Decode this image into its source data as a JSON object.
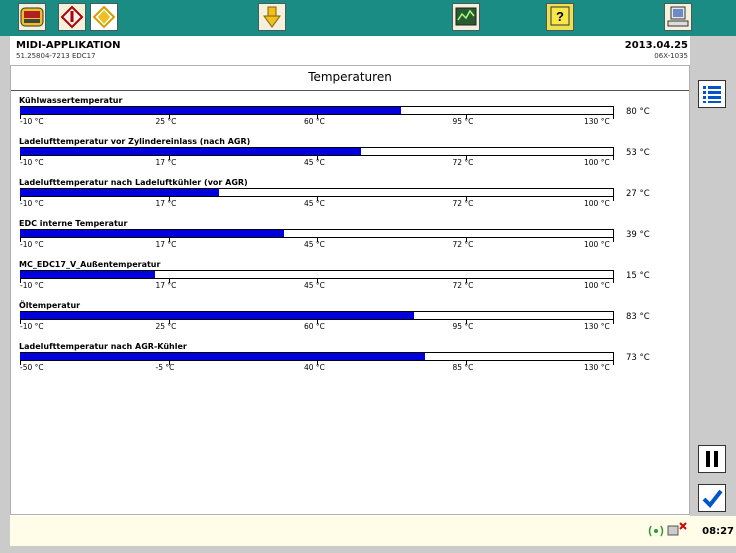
{
  "toolbar": {
    "buttons": [
      {
        "id": "man-logo",
        "icon": "man-logo-icon",
        "label": "MAN"
      },
      {
        "id": "diagnostic",
        "icon": "diagnostic-arrow-icon"
      },
      {
        "id": "tests",
        "icon": "tests-arrow-icon"
      },
      {
        "id": "measurements",
        "icon": "measurement-icon"
      },
      {
        "id": "graph",
        "icon": "graph-icon"
      },
      {
        "id": "help",
        "icon": "help-icon",
        "label": "?"
      },
      {
        "id": "computer",
        "icon": "computer-icon"
      }
    ]
  },
  "header": {
    "app_title": "MIDI-APPLIKATION",
    "app_sub": "51.25804-7213  EDC17",
    "date": "2013.04.25",
    "date_sub": "06X-1035"
  },
  "page_title": "Temperaturen",
  "measurements": [
    {
      "label": "Kühlwassertemperatur",
      "value": "80 °C",
      "fill": 0.643,
      "ticks": [
        "-10 °C",
        "25 °C",
        "60 °C",
        "95 °C",
        "130 °C"
      ]
    },
    {
      "label": "Ladelufttemperatur vor Zylindereinlass (nach AGR)",
      "value": "53 °C",
      "fill": 0.575,
      "ticks": [
        "-10 °C",
        "17 °C",
        "45 °C",
        "72 °C",
        "100 °C"
      ]
    },
    {
      "label": "Ladelufttemperatur nach Ladeluftkühler (vor AGR)",
      "value": "27 °C",
      "fill": 0.336,
      "ticks": [
        "-10 °C",
        "17 °C",
        "45 °C",
        "72 °C",
        "100 °C"
      ]
    },
    {
      "label": "EDC interne Temperatur",
      "value": "39 °C",
      "fill": 0.445,
      "ticks": [
        "-10 °C",
        "17 °C",
        "45 °C",
        "72 °C",
        "100 °C"
      ]
    },
    {
      "label": "MC_EDC17_V_Außentemperatur",
      "value": "15 °C",
      "fill": 0.227,
      "ticks": [
        "-10 °C",
        "17 °C",
        "45 °C",
        "72 °C",
        "100 °C"
      ]
    },
    {
      "label": "Öltemperatur",
      "value": "83 °C",
      "fill": 0.664,
      "ticks": [
        "-10 °C",
        "25 °C",
        "60 °C",
        "95 °C",
        "130 °C"
      ]
    },
    {
      "label": "Ladelufttemperatur nach AGR-Kühler",
      "value": "73 °C",
      "fill": 0.683,
      "ticks": [
        "-50 °C",
        "-5 °C",
        "40 °C",
        "85 °C",
        "130 °C"
      ]
    }
  ],
  "rightbar": {
    "list_icon": "list-icon",
    "pause_icon": "pause-icon",
    "confirm_icon": "checkmark-icon"
  },
  "status": {
    "time": "08:27",
    "connection_icon": "connection-status-icon"
  },
  "colors": {
    "toolbar": "#1a8c84",
    "bar_fill": "#0000dd",
    "side": "#cbcbcb",
    "status": "#fffde8"
  }
}
